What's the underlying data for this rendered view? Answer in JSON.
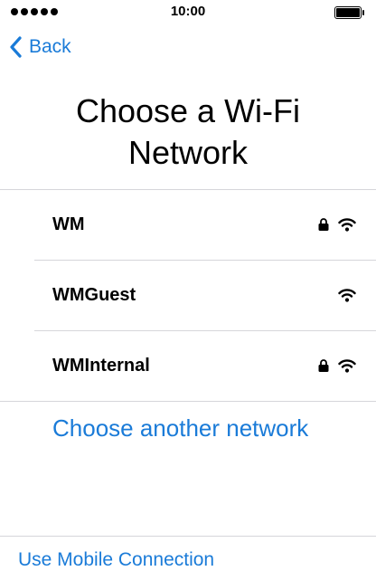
{
  "status_bar": {
    "time": "10:00"
  },
  "nav": {
    "back_label": "Back"
  },
  "page": {
    "title_line1": "Choose a Wi-Fi",
    "title_line2": "Network"
  },
  "networks": [
    {
      "name": "WM",
      "secured": true
    },
    {
      "name": "WMGuest",
      "secured": false
    },
    {
      "name": "WMInternal",
      "secured": true
    }
  ],
  "actions": {
    "other_network": "Choose another network",
    "mobile_connection": "Use Mobile Connection"
  },
  "colors": {
    "accent": "#1a7bd8",
    "separator": "#d6d6da"
  },
  "icons": [
    "signal-dots-icon",
    "battery-icon",
    "chevron-left-icon",
    "lock-icon",
    "wifi-icon"
  ]
}
